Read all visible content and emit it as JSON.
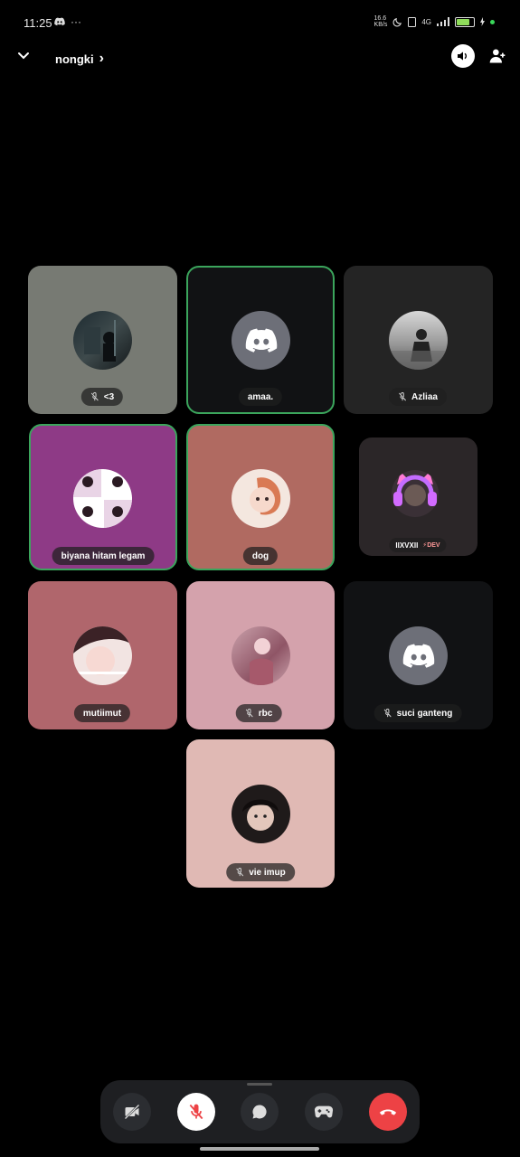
{
  "status_bar": {
    "time": "11:25",
    "more": "···",
    "net_speed": "16.6\nKB/s",
    "network": "4G",
    "battery_level": 0.8
  },
  "header": {
    "channel_name": "nongki",
    "chevron": "›"
  },
  "participants": [
    {
      "name": "<3",
      "muted": true,
      "speaking": false,
      "bg": "#777a73"
    },
    {
      "name": "amaa.",
      "muted": false,
      "speaking": true,
      "bg": "#111214",
      "default_avatar": true
    },
    {
      "name": "Azliaa",
      "muted": true,
      "speaking": false,
      "bg": "#242424"
    },
    {
      "name": "biyana hitam legam",
      "muted": false,
      "speaking": true,
      "bg": "#8e3a86"
    },
    {
      "name": "dog",
      "muted": false,
      "speaking": true,
      "bg": "#b06a61"
    },
    {
      "name": "IIXVXII",
      "tag": "⚡DEV",
      "muted": false,
      "speaking": false,
      "bg": "#2b2628"
    },
    {
      "name": "mutiimut",
      "muted": false,
      "speaking": false,
      "bg": "#b0666c"
    },
    {
      "name": "rbc",
      "muted": true,
      "speaking": false,
      "bg": "#d4a2ac"
    },
    {
      "name": "suci ganteng",
      "muted": true,
      "speaking": false,
      "bg": "#111214",
      "default_avatar": true
    },
    {
      "name": "vie imup",
      "muted": true,
      "speaking": false,
      "bg": "#e0b9b4"
    }
  ],
  "controls": [
    {
      "name": "camera-off",
      "state": "off"
    },
    {
      "name": "mic-muted",
      "state": "muted"
    },
    {
      "name": "chat"
    },
    {
      "name": "activities"
    },
    {
      "name": "disconnect"
    }
  ],
  "colors": {
    "speaking_border": "#3ba55c",
    "disconnect": "#ed4245",
    "discord_blurple": "#5865f2",
    "default_avatar_bg": "#6d6f78"
  }
}
